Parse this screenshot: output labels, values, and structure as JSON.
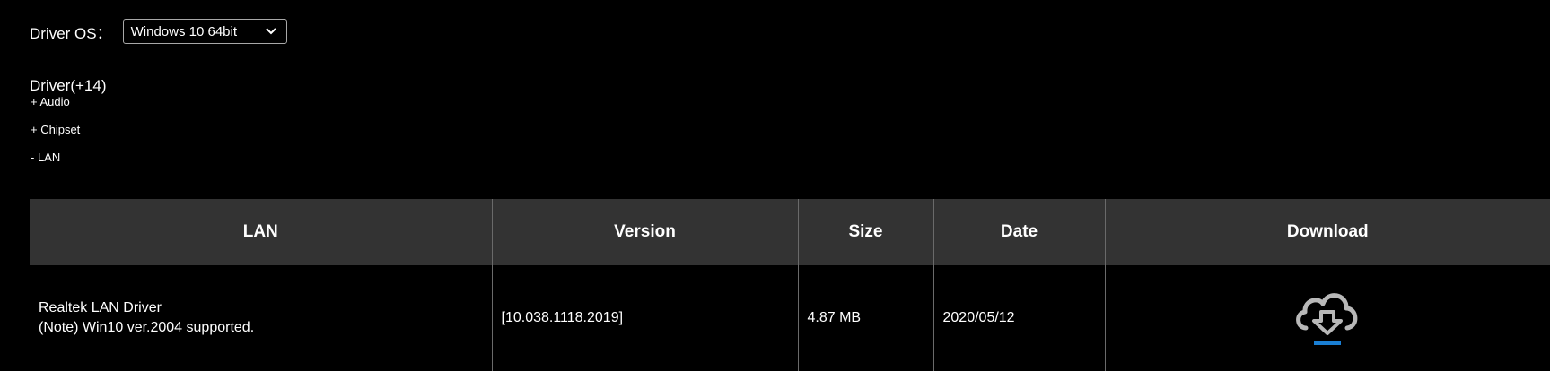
{
  "os_filter": {
    "label": "Driver OS：",
    "selected": "Windows 10 64bit"
  },
  "driver_section": {
    "title": "Driver(+14)",
    "categories": [
      {
        "label": "+ Audio"
      },
      {
        "label": "+ Chipset"
      },
      {
        "label": "- LAN"
      }
    ]
  },
  "table": {
    "headers": [
      "LAN",
      "Version",
      "Size",
      "Date",
      "Download"
    ],
    "rows": [
      {
        "name": "Realtek LAN Driver",
        "note": "(Note) Win10 ver.2004 supported.",
        "version": "[10.038.1118.2019]",
        "size": "4.87 MB",
        "date": "2020/05/12",
        "download_icon": "cloud-download-icon"
      }
    ]
  },
  "colors": {
    "background": "#000000",
    "header_bg": "#333333",
    "download_accent": "#1a7fd4",
    "icon_gray": "#b8b8b8"
  }
}
